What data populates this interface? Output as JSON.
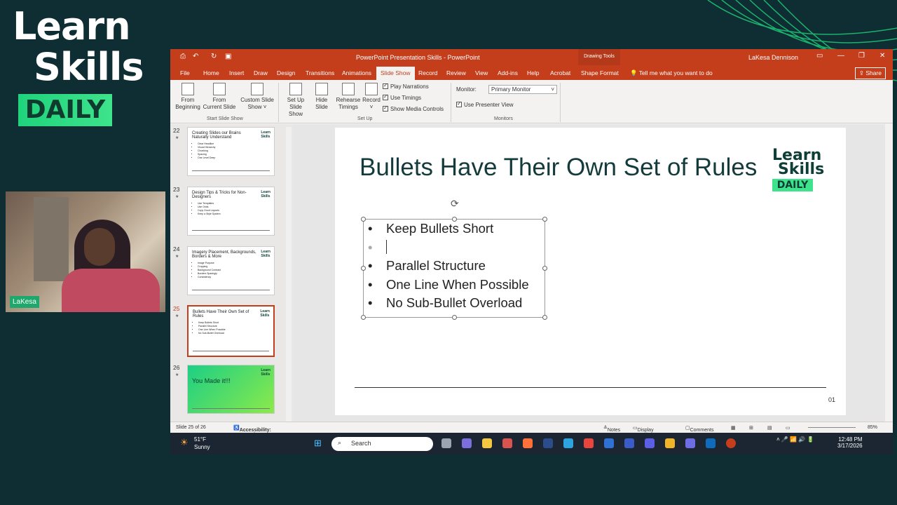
{
  "brand": {
    "line1": "Learn",
    "line2": "Skills",
    "daily": "DAILY"
  },
  "webcam": {
    "name": "LaKesa"
  },
  "window": {
    "title": "PowerPoint Presentation Skills  -  PowerPoint",
    "drawing_tools": "Drawing Tools",
    "user": "LaKesa Dennison",
    "user_initials": "LD"
  },
  "tabs": [
    "File",
    "Home",
    "Insert",
    "Draw",
    "Design",
    "Transitions",
    "Animations",
    "Slide Show",
    "Record",
    "Review",
    "View",
    "Add-ins",
    "Help",
    "Acrobat",
    "Shape Format"
  ],
  "active_tab": "Slide Show",
  "tell_me": "Tell me what you want to do",
  "share": "Share",
  "ribbon": {
    "from_beginning": "From\nBeginning",
    "from_current": "From\nCurrent Slide",
    "custom_show": "Custom Slide\nShow ˅",
    "start_group": "Start Slide Show",
    "setup_show": "Set Up\nSlide Show",
    "hide_slide": "Hide\nSlide",
    "rehearse": "Rehearse\nTimings",
    "record": "Record\n˅",
    "play_narrations": "Play Narrations",
    "use_timings": "Use Timings",
    "show_media": "Show Media Controls",
    "setup_group": "Set Up",
    "monitor_label": "Monitor:",
    "monitor_value": "Primary Monitor",
    "presenter_view": "Use Presenter View",
    "monitors_group": "Monitors"
  },
  "thumbnails": [
    {
      "num": "22",
      "title": "Creating Slides our Brains Naturally Understand",
      "bullets": [
        "Clear Headline",
        "Visual Hierarchy",
        "Chunking",
        "Spacing",
        "One Level Deep"
      ]
    },
    {
      "num": "23",
      "title": "Design Tips & Tricks for Non-Designers",
      "bullets": [
        "Use Templates",
        "Use Grids",
        "Copy Good Layouts",
        "Keep a Style System"
      ]
    },
    {
      "num": "24",
      "title": "Imagery Placement, Backgrounds, Borders & More",
      "bullets": [
        "Image Purpose",
        "Cropping",
        "Background Contrast",
        "Borders Sparingly",
        "Consistency"
      ]
    },
    {
      "num": "25",
      "title": "Bullets Have Their Own Set of Rules",
      "bullets": [
        "Keep Bullets Short",
        "Parallel Structure",
        "One Line When Possible",
        "No Sub-Bullet Overload"
      ]
    },
    {
      "num": "26",
      "title": "You Made it!!!",
      "bullets": []
    }
  ],
  "slide": {
    "title": "Bullets Have Their Own Set of Rules",
    "logo_line1": "Learn",
    "logo_line2": "Skills",
    "logo_daily": "DAILY",
    "bullets": [
      "Keep Bullets Short",
      "",
      "Parallel  Structure",
      "One Line When Possible",
      "No Sub-Bullet Overload"
    ],
    "number": "01"
  },
  "status": {
    "slide_of": "Slide 25 of 26",
    "accessibility": "Accessibility: Investigate",
    "notes": "Notes",
    "display": "Display Settings",
    "comments": "Comments",
    "zoom": "85%"
  },
  "taskbar": {
    "temp": "51°F",
    "weather": "Sunny",
    "search": "Search",
    "time": "12:48 PM",
    "date": "3/17/2026"
  }
}
